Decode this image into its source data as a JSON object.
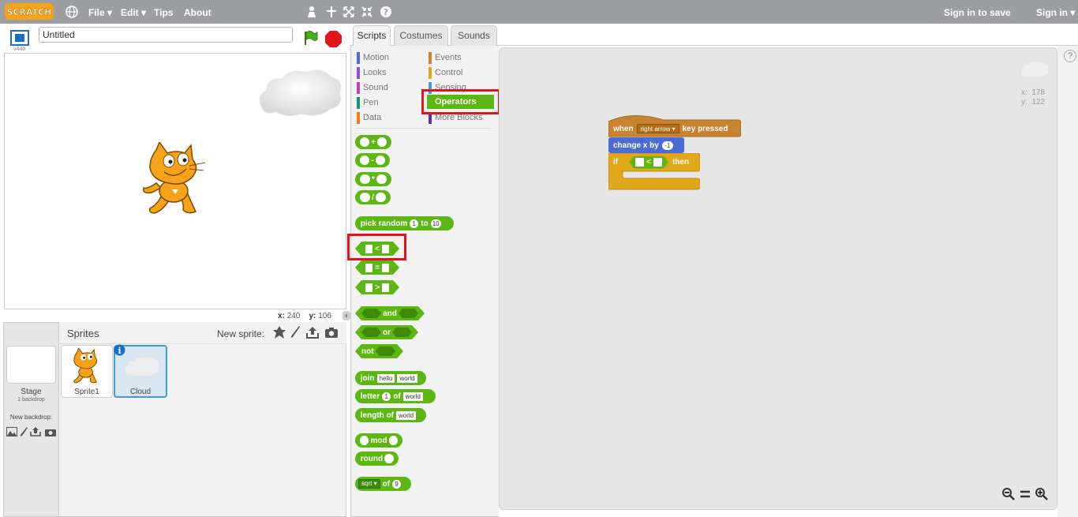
{
  "menu": {
    "file": "File",
    "edit": "Edit",
    "tips": "Tips",
    "about": "About",
    "sign_in_to_save": "Sign in to save",
    "sign_in": "Sign in"
  },
  "project": {
    "title": "Untitled",
    "version": "v440"
  },
  "stage": {
    "x_label": "x:",
    "x_value": "240",
    "y_label": "y:",
    "y_value": "106"
  },
  "tabs": [
    "Scripts",
    "Costumes",
    "Sounds"
  ],
  "categories_left": [
    "Motion",
    "Looks",
    "Sound",
    "Pen",
    "Data"
  ],
  "categories_right": [
    "Events",
    "Control",
    "Sensing",
    "Operators",
    "More Blocks"
  ],
  "category_colors": {
    "motion": "#4a6cd4",
    "looks": "#8a55d7",
    "sound": "#bb42c3",
    "pen": "#0e9a6c",
    "data": "#ee7d16",
    "events": "#c88330",
    "control": "#e1a91a",
    "sensing": "#2ca5e2",
    "operators": "#5cb712",
    "more": "#632d99"
  },
  "blocks": {
    "plus": "+",
    "minus": "-",
    "times": "*",
    "divide": "/",
    "pick_random": "pick random",
    "pick_from": "1",
    "pick_to_word": "to",
    "pick_to": "10",
    "lt": "<",
    "eq": "=",
    "gt": ">",
    "and": "and",
    "or": "or",
    "not": "not",
    "join": "join",
    "join_a": "hello",
    "join_b": "world",
    "letter": "letter",
    "letter_n": "1",
    "letter_of": "of",
    "letter_word": "world",
    "length": "length",
    "length_of": "of",
    "length_word": "world",
    "mod": "mod",
    "round": "round",
    "sqrt": "sqrt",
    "sqrt_of": "of",
    "sqrt_val": "9"
  },
  "script": {
    "when": "when",
    "key": "right arrow",
    "key_pressed": "key pressed",
    "change_x": "change x by",
    "change_val": "-1",
    "if": "if",
    "cond_op": "<",
    "then": "then"
  },
  "canvas_coords": {
    "x_label": "x:",
    "x": "178",
    "y_label": "y:",
    "y": "122"
  },
  "sprites": {
    "title": "Sprites",
    "new_sprite": "New sprite:",
    "stage_label": "Stage",
    "stage_backdrops": "1 backdrop",
    "new_backdrop": "New backdrop:",
    "items": [
      "Sprite1",
      "Cloud"
    ]
  }
}
